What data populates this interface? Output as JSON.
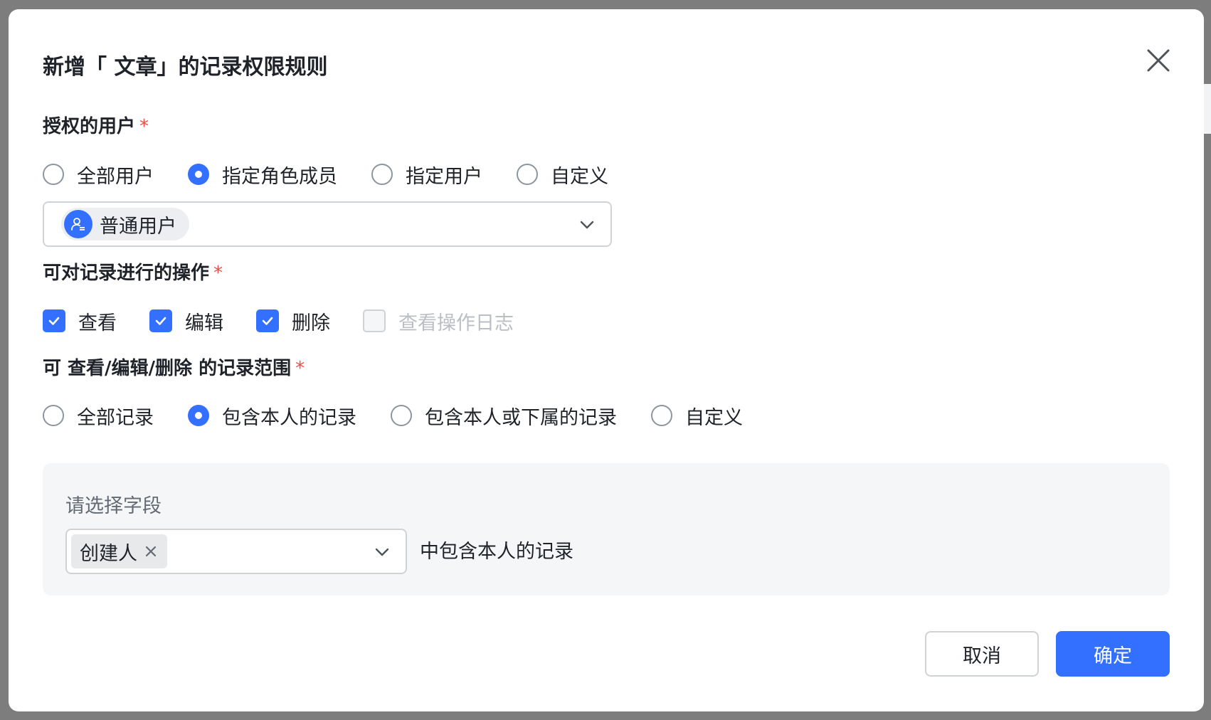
{
  "background": {
    "clipped_text": "名"
  },
  "dialog": {
    "title": "新增「 文章」的记录权限规则",
    "close_icon": "close-icon"
  },
  "authorized_users": {
    "label": "授权的用户",
    "required_mark": "*",
    "options": [
      {
        "label": "全部用户",
        "checked": false
      },
      {
        "label": "指定角色成员",
        "checked": true
      },
      {
        "label": "指定用户",
        "checked": false
      },
      {
        "label": "自定义",
        "checked": false
      }
    ],
    "selected_role": {
      "label": "普通用户",
      "icon": "role-icon"
    }
  },
  "operations": {
    "label": "可对记录进行的操作",
    "required_mark": "*",
    "items": [
      {
        "label": "查看",
        "checked": true,
        "disabled": false
      },
      {
        "label": "编辑",
        "checked": true,
        "disabled": false
      },
      {
        "label": "删除",
        "checked": true,
        "disabled": false
      },
      {
        "label": "查看操作日志",
        "checked": false,
        "disabled": true
      }
    ]
  },
  "scope": {
    "label": "可 查看/编辑/删除 的记录范围",
    "required_mark": "*",
    "options": [
      {
        "label": "全部记录",
        "checked": false
      },
      {
        "label": "包含本人的记录",
        "checked": true
      },
      {
        "label": "包含本人或下属的记录",
        "checked": false
      },
      {
        "label": "自定义",
        "checked": false
      }
    ],
    "field_label": "请选择字段",
    "selected_field": "创建人",
    "suffix": "中包含本人的记录"
  },
  "footer": {
    "cancel": "取消",
    "confirm": "确定"
  },
  "colors": {
    "primary": "#3370ff",
    "required": "#f54a45",
    "disabled_text": "#bbbfc4"
  }
}
